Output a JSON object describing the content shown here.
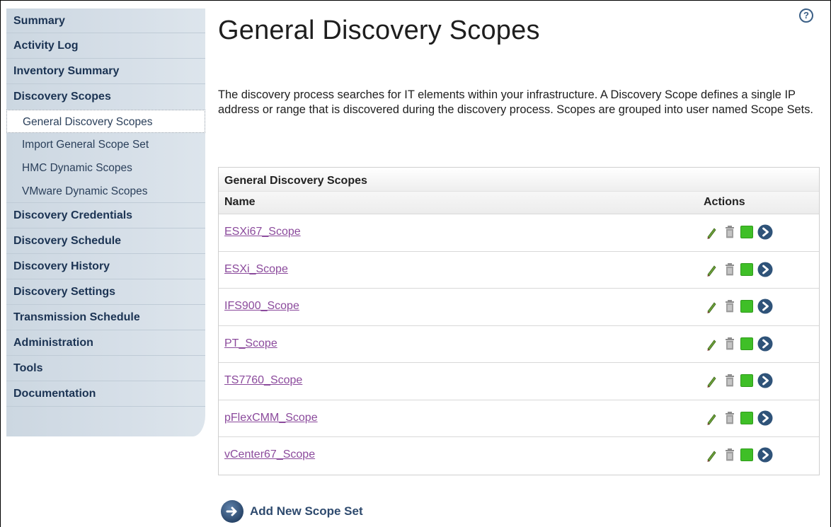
{
  "sidebar": {
    "items": [
      {
        "label": "Summary"
      },
      {
        "label": "Activity Log"
      },
      {
        "label": "Inventory Summary"
      },
      {
        "label": "Discovery Scopes"
      },
      {
        "label": "Discovery Credentials"
      },
      {
        "label": "Discovery Schedule"
      },
      {
        "label": "Discovery History"
      },
      {
        "label": "Discovery Settings"
      },
      {
        "label": "Transmission Schedule"
      },
      {
        "label": "Administration"
      },
      {
        "label": "Tools"
      },
      {
        "label": "Documentation"
      }
    ],
    "subitems": [
      {
        "label": "General Discovery Scopes",
        "active": true
      },
      {
        "label": "Import General Scope Set"
      },
      {
        "label": "HMC Dynamic Scopes"
      },
      {
        "label": "VMware Dynamic Scopes"
      }
    ]
  },
  "help": {
    "icon": "help-icon",
    "label": "?"
  },
  "page": {
    "title": "General Discovery Scopes",
    "intro": "The discovery process searches for IT elements within your infrastructure. A Discovery Scope defines a single IP address or range that is discovered during the discovery process. Scopes are grouped into user named Scope Sets."
  },
  "table": {
    "caption": "General Discovery Scopes",
    "columns": {
      "name": "Name",
      "actions": "Actions"
    },
    "rows": [
      {
        "name": "ESXi67_Scope"
      },
      {
        "name": "ESXi_Scope"
      },
      {
        "name": "IFS900_Scope"
      },
      {
        "name": "PT_Scope"
      },
      {
        "name": "TS7760_Scope"
      },
      {
        "name": "pFlexCMM_Scope"
      },
      {
        "name": "vCenter67_Scope"
      }
    ],
    "action_icons": [
      "pencil-icon",
      "trash-icon",
      "start-icon",
      "arrow-circle-icon"
    ]
  },
  "add_new": {
    "label": "Add New Scope Set",
    "icon": "arrow-circle-icon"
  },
  "colors": {
    "link": "#8b4a9c",
    "nav_text": "#1b3353",
    "start_green": "#3fbf27",
    "circle_blue": "#2f5379"
  }
}
